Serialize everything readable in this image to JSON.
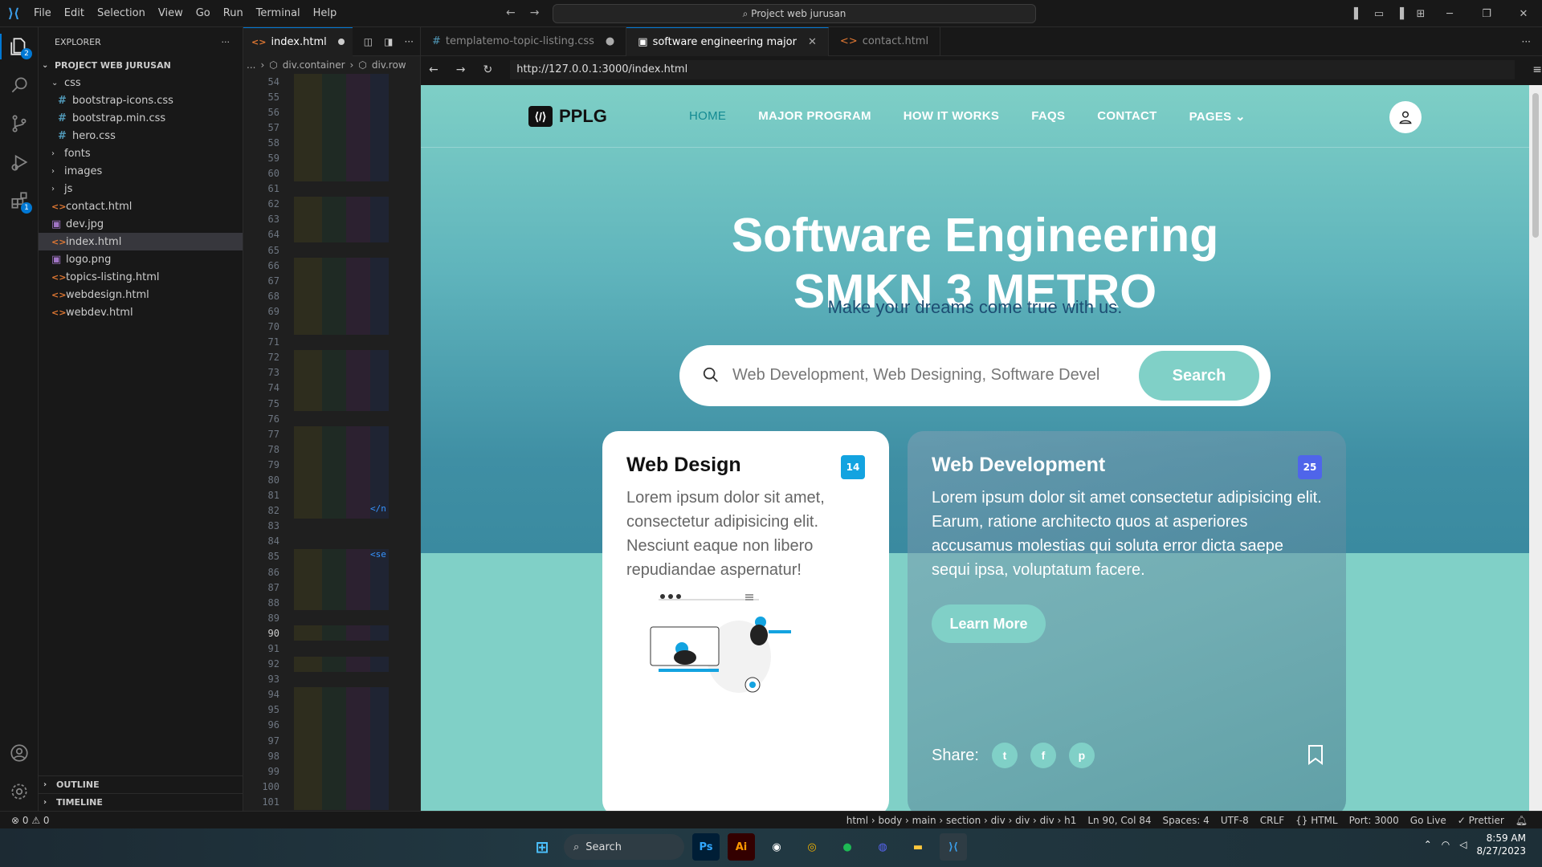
{
  "titlebar": {
    "menus": [
      "File",
      "Edit",
      "Selection",
      "View",
      "Go",
      "Run",
      "Terminal",
      "Help"
    ],
    "command_center": "Project web jurusan"
  },
  "activity": {
    "explorer_badge": "2",
    "extensions_badge": "1"
  },
  "sidebar": {
    "title": "EXPLORER",
    "project": "PROJECT WEB JURUSAN",
    "items": [
      {
        "label": "css",
        "type": "folder-open",
        "indent": 0
      },
      {
        "label": "bootstrap-icons.css",
        "type": "css",
        "indent": 1
      },
      {
        "label": "bootstrap.min.css",
        "type": "css",
        "indent": 1
      },
      {
        "label": "hero.css",
        "type": "css",
        "indent": 1
      },
      {
        "label": "fonts",
        "type": "folder",
        "indent": 0
      },
      {
        "label": "images",
        "type": "folder",
        "indent": 0
      },
      {
        "label": "js",
        "type": "folder",
        "indent": 0
      },
      {
        "label": "contact.html",
        "type": "html",
        "indent": 0
      },
      {
        "label": "dev.jpg",
        "type": "img",
        "indent": 0
      },
      {
        "label": "index.html",
        "type": "html",
        "indent": 0,
        "selected": true
      },
      {
        "label": "logo.png",
        "type": "img",
        "indent": 0
      },
      {
        "label": "topics-listing.html",
        "type": "html",
        "indent": 0
      },
      {
        "label": "webdesign.html",
        "type": "html",
        "indent": 0
      },
      {
        "label": "webdev.html",
        "type": "html",
        "indent": 0
      }
    ],
    "outline": "OUTLINE",
    "timeline": "TIMELINE"
  },
  "editor": {
    "tab": "index.html",
    "breadcrumb": [
      "...",
      "div.container",
      "div.row"
    ],
    "line_start": 54,
    "line_end": 101,
    "current_line": 90,
    "snippets": {
      "82": "</n",
      "85": "<se"
    }
  },
  "preview": {
    "tabs": [
      {
        "label": "templatemo-topic-listing.css",
        "icon": "#",
        "dirty": true
      },
      {
        "label": "software engineering major",
        "icon": "▣",
        "active": true
      },
      {
        "label": "contact.html",
        "icon": "<>"
      }
    ],
    "url": "http://127.0.0.1:3000/index.html"
  },
  "site": {
    "logo": "PPLG",
    "nav": [
      "HOME",
      "MAJOR PROGRAM",
      "HOW IT WORKS",
      "FAQS",
      "CONTACT",
      "PAGES"
    ],
    "title_line1": "Software Engineering",
    "title_line2": "SMKN 3 METRO",
    "subtitle": "Make your dreams come true with us.",
    "search_placeholder": "Web Development, Web Designing, Software Devel",
    "search_button": "Search",
    "card1": {
      "title": "Web Design",
      "badge": "14",
      "text": "Lorem ipsum dolor sit amet, consectetur adipisicing elit. Nesciunt eaque non libero repudiandae aspernatur!"
    },
    "card2": {
      "title": "Web Development",
      "badge": "25",
      "text": "Lorem ipsum dolor sit amet consectetur adipisicing elit. Earum, ratione architecto quos at asperiores accusamus molestias qui soluta error dicta saepe sequi ipsa, voluptatum facere.",
      "button": "Learn More",
      "share": "Share:"
    }
  },
  "statusbar": {
    "problems": "⊗ 0 ⚠ 0",
    "path": "html › body › main › section › div › div › div › h1",
    "position": "Ln 90, Col 84",
    "spaces": "Spaces: 4",
    "encoding": "UTF-8",
    "eol": "CRLF",
    "language": "{} HTML",
    "port": "Port: 3000",
    "golive": "Go Live",
    "prettier": "✓ Prettier"
  },
  "taskbar": {
    "search": "Search",
    "time": "8:59 AM",
    "date": "8/27/2023"
  },
  "colors": {
    "accent": "#80d0c7",
    "nav_active": "#138a92",
    "badge_blue": "#13a3e0",
    "badge_purple": "#4f65ea"
  }
}
